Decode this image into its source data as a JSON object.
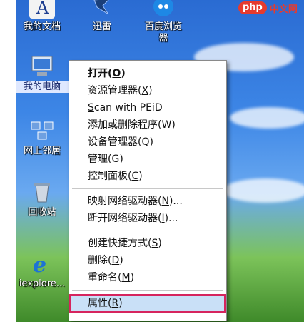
{
  "watermark": {
    "logo": "php",
    "text": "中文网"
  },
  "desktop": {
    "icons": [
      {
        "label": "我的文档",
        "icon": "documents-icon"
      },
      {
        "label": "迅雷",
        "icon": "thunder-icon"
      },
      {
        "label": "百度浏览器",
        "icon": "browser-icon"
      },
      {
        "label": "我的电脑",
        "icon": "computer-icon"
      },
      {
        "label": "网上邻居",
        "icon": "network-icon"
      },
      {
        "label": "回收站",
        "icon": "recycle-bin-icon"
      },
      {
        "label": "iexplore...",
        "icon": "ie-icon"
      }
    ]
  },
  "menu": {
    "items": [
      {
        "text": "打开(",
        "key": "O",
        "end": ")"
      },
      {
        "text": "资源管理器(",
        "key": "X",
        "end": ")"
      },
      {
        "text": "",
        "key": "S",
        "end": "can with PEiD"
      },
      {
        "text": "添加或删除程序(",
        "key": "W",
        "end": ")"
      },
      {
        "text": "设备管理器(",
        "key": "Q",
        "end": ")"
      },
      {
        "text": "管理(",
        "key": "G",
        "end": ")"
      },
      {
        "text": "控制面板(",
        "key": "C",
        "end": ")"
      },
      {
        "text": "映射网络驱动器(",
        "key": "N",
        "end": ")..."
      },
      {
        "text": "断开网络驱动器(",
        "key": "I",
        "end": ")..."
      },
      {
        "text": "创建快捷方式(",
        "key": "S",
        "end": ")"
      },
      {
        "text": "删除(",
        "key": "D",
        "end": ")"
      },
      {
        "text": "重命名(",
        "key": "M",
        "end": ")"
      },
      {
        "text": "属性(",
        "key": "R",
        "end": ")"
      }
    ]
  }
}
